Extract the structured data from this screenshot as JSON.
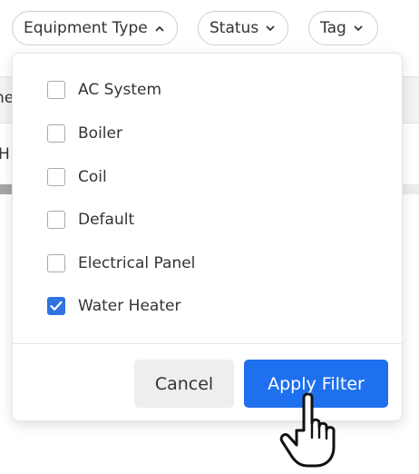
{
  "filters": {
    "equipment_type": {
      "label": "Equipment Type",
      "chevron": "chevron-up-icon"
    },
    "status": {
      "label": "Status",
      "chevron": "chevron-down-icon"
    },
    "tag": {
      "label": "Tag",
      "chevron": "chevron-down-icon"
    }
  },
  "background": {
    "header_fragment": "ne",
    "row_fragment": "H"
  },
  "dropdown": {
    "options": [
      {
        "label": "AC System",
        "checked": false
      },
      {
        "label": "Boiler",
        "checked": false
      },
      {
        "label": "Coil",
        "checked": false
      },
      {
        "label": "Default",
        "checked": false
      },
      {
        "label": "Electrical Panel",
        "checked": false
      },
      {
        "label": "Water Heater",
        "checked": true
      }
    ],
    "cancel_label": "Cancel",
    "apply_label": "Apply Filter"
  },
  "colors": {
    "accent": "#1f70ee",
    "checkbox_checked": "#2f73e0",
    "cancel_bg": "#eeeeee"
  },
  "cursor": {
    "icon": "hand-pointer-icon"
  }
}
